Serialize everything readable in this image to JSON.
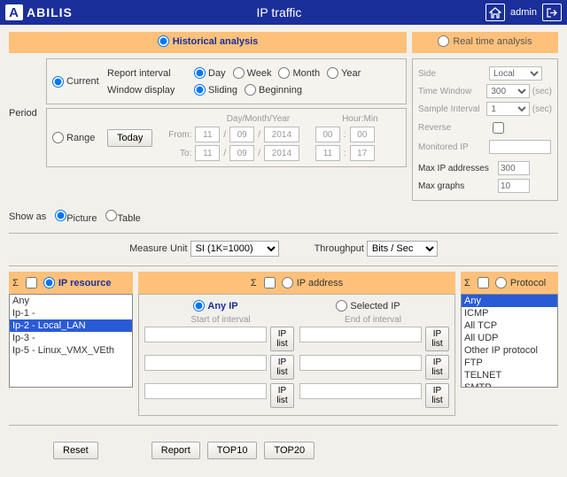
{
  "topbar": {
    "brand": "ABILIS",
    "title": "IP traffic",
    "admin": "admin"
  },
  "analysis": {
    "historical_label": "Historical analysis",
    "realtime_label": "Real time analysis"
  },
  "period": {
    "label": "Period",
    "current_label": "Current",
    "range_label": "Range",
    "report_interval_label": "Report interval",
    "window_display_label": "Window display",
    "interval": {
      "day": "Day",
      "week": "Week",
      "month": "Month",
      "year": "Year"
    },
    "window": {
      "sliding": "Sliding",
      "beginning": "Beginning"
    },
    "today_btn": "Today",
    "date_head1": "Day/Month/Year",
    "date_head2": "Hour:Min",
    "from_label": "From:",
    "to_label": "To:",
    "from": {
      "d": "11",
      "m": "09",
      "y": "2014",
      "h": "00",
      "min": "00"
    },
    "to": {
      "d": "11",
      "m": "09",
      "y": "2014",
      "h": "11",
      "min": "17"
    }
  },
  "rt": {
    "side_label": "Side",
    "side_value": "Local",
    "timewin_label": "Time Window",
    "timewin_value": "300",
    "sample_label": "Sample Interval",
    "sample_value": "1",
    "sec": "(sec)",
    "reverse_label": "Reverse",
    "monitored_label": "Monitored IP",
    "monitored_value": "",
    "maxip_label": "Max IP addresses",
    "maxip_value": "300",
    "maxgraph_label": "Max graphs",
    "maxgraph_value": "10"
  },
  "show": {
    "label": "Show as",
    "picture": "Picture",
    "table": "Table"
  },
  "mu": {
    "label": "Measure Unit",
    "value": "SI (1K=1000)",
    "tp_label": "Throughput",
    "tp_value": "Bits / Sec"
  },
  "cols": {
    "sigma": "Σ",
    "ipres_label": "IP resource",
    "ipaddr_label": "IP address",
    "proto_label": "Protocol",
    "anyip": "Any IP",
    "selip": "Selected IP",
    "start": "Start of interval",
    "end": "End of interval",
    "iplist_btn": "IP list"
  },
  "ip_resources": [
    "Any",
    "Ip-1 -",
    "Ip-2 - Local_LAN",
    "Ip-3 -",
    "Ip-5 - Linux_VMX_VEth"
  ],
  "ip_selected_index": 2,
  "protocols": [
    "Any",
    "ICMP",
    "All TCP",
    "All UDP",
    "Other IP protocol",
    "FTP",
    "TELNET",
    "SMTP"
  ],
  "proto_selected_index": 0,
  "footer": {
    "reset": "Reset",
    "report": "Report",
    "top10": "TOP10",
    "top20": "TOP20"
  }
}
